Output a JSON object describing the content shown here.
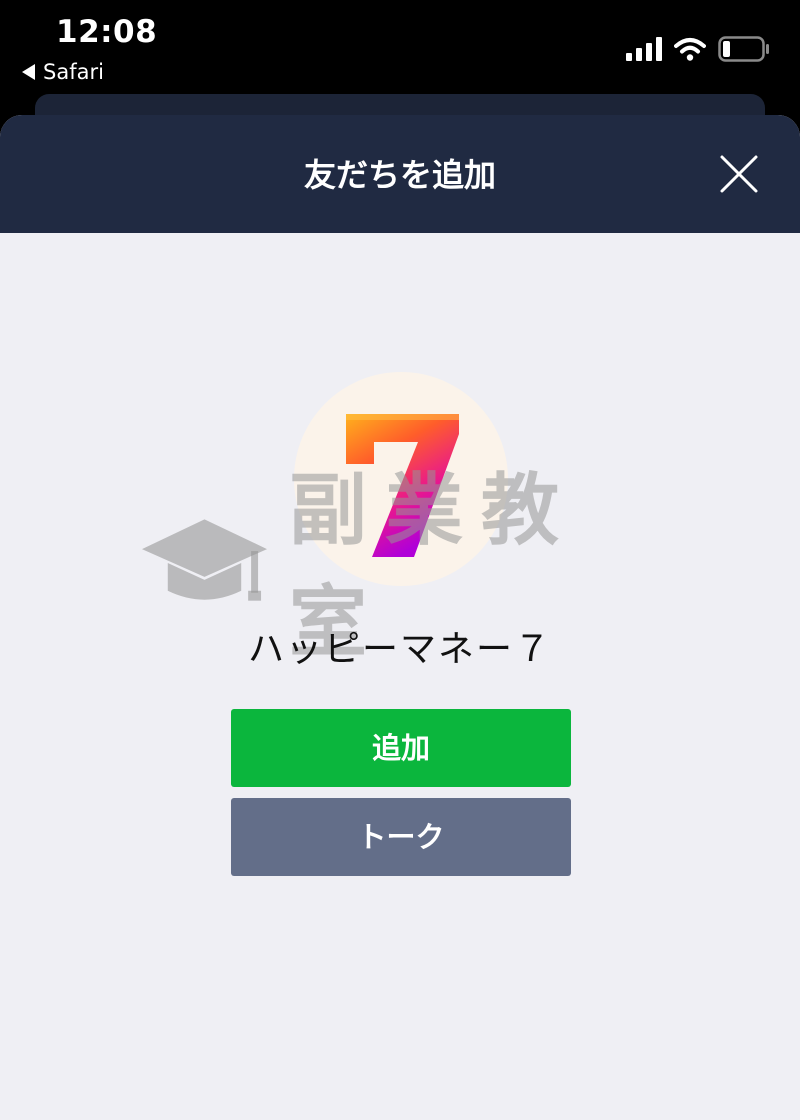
{
  "status_bar": {
    "time": "12:08",
    "back_label": "Safari",
    "icons": [
      "signal-icon",
      "wifi-icon",
      "battery-icon"
    ]
  },
  "dialog": {
    "title": "友だちを追加",
    "close_icon": "close-icon"
  },
  "account": {
    "avatar_glyph": "7",
    "name": "ハッピーマネー７"
  },
  "watermark": {
    "text": "副業教室",
    "icon": "graduation-cap-icon"
  },
  "buttons": {
    "add_label": "追加",
    "talk_label": "トーク"
  },
  "colors": {
    "header_bg": "#202a42",
    "add_button": "#0bb63d",
    "talk_button": "#636e89",
    "sheet_bg": "#efeff4",
    "avatar_bg": "#fbf3ea"
  }
}
